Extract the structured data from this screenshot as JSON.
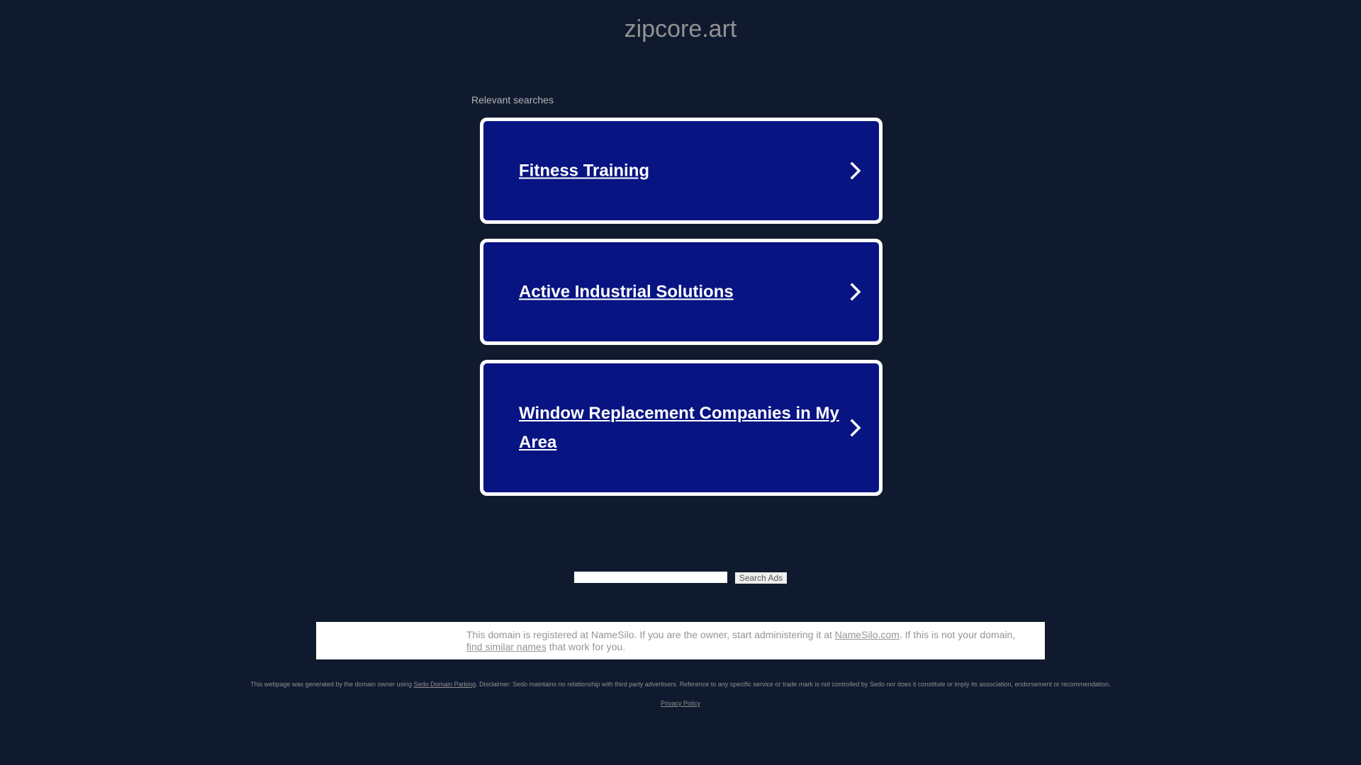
{
  "header": {
    "domain": "zipcore.art"
  },
  "relevant": {
    "label": "Relevant searches",
    "items": [
      {
        "text": "Fitness Training"
      },
      {
        "text": "Active Industrial Solutions"
      },
      {
        "text": "Window Replacement Companies in My Area"
      }
    ]
  },
  "search": {
    "button_label": "Search Ads",
    "value": ""
  },
  "registrar": {
    "text_part1": "This domain is registered at NameSilo. If you are the owner, start administering it at ",
    "link_namesilo": "NameSilo.com",
    "text_part2": ". If this is not your domain, ",
    "link_similar": "find similar names",
    "text_part3": " that work for you."
  },
  "footer": {
    "disclaimer_part1": "This webpage was generated by the domain owner using ",
    "link_sedo": "Sedo Domain Parking",
    "disclaimer_part2": ". Disclaimer: Sedo maintains no relationship with third party advertisers. Reference to any specific service or trade mark is not controlled by Sedo nor does it constitute or imply its association, endorsement or recommendation.",
    "privacy_label": "Privacy Policy"
  },
  "colors": {
    "background": "#101a2f",
    "card_fill": "#081482",
    "card_border": "#ffffff"
  },
  "icons": {
    "card_arrow": "chevron-right-icon"
  }
}
